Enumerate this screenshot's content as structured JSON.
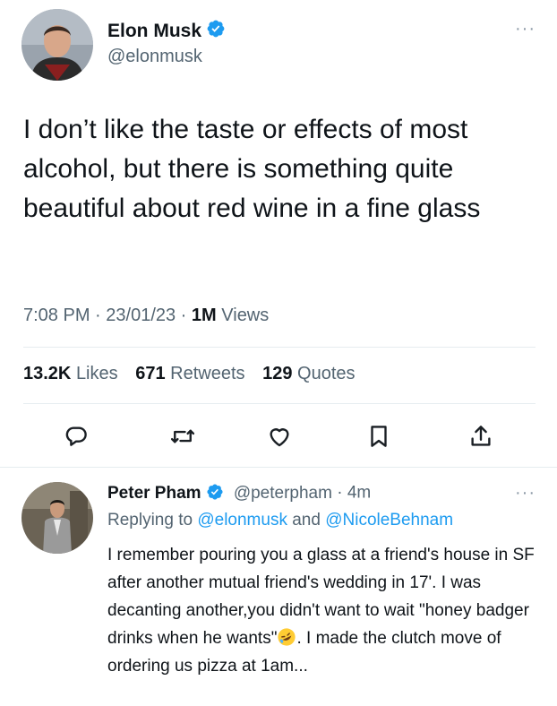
{
  "tweet": {
    "author": {
      "name": "Elon Musk",
      "handle": "@elonmusk",
      "avatar_icon": "avatar-photo",
      "verified": true
    },
    "more_icon": "more-horizontal-icon",
    "text": "I don’t like the taste or effects of most alcohol, but there is something quite beautiful about red wine in a fine glass",
    "meta": {
      "time": "7:08 PM",
      "separator": " · ",
      "date": "23/01/23",
      "views_count": "1M",
      "views_label": "Views"
    },
    "stats": [
      {
        "count": "13.2K",
        "label": "Likes"
      },
      {
        "count": "671",
        "label": "Retweets"
      },
      {
        "count": "129",
        "label": "Quotes"
      }
    ],
    "actions": [
      {
        "icon": "reply-icon"
      },
      {
        "icon": "retweet-icon"
      },
      {
        "icon": "like-heart-icon"
      },
      {
        "icon": "bookmark-icon"
      },
      {
        "icon": "share-icon"
      }
    ]
  },
  "reply": {
    "author": {
      "name": "Peter Pham",
      "handle": "@peterpham",
      "separator": " · ",
      "time": "4m",
      "verified": true
    },
    "replying_prefix": "Replying to ",
    "replying_to": [
      "@elonmusk",
      "@NicoleBehnam"
    ],
    "replying_joiner": " and ",
    "text_before_emoji": "I remember pouring you a glass at a friend's house in SF after another mutual friend's wedding in 17'.  I was decanting another,you didn't want to wait \"honey badger drinks when he wants\"",
    "emoji_icon": "rofl-emoji-icon",
    "text_after_emoji": ". I made the clutch move of ordering us pizza at 1am..."
  },
  "colors": {
    "text": "#0f1419",
    "secondary": "#536471",
    "link": "#1d9bf0",
    "verified": "#1d9bf0",
    "divider": "#e6ecf0"
  }
}
